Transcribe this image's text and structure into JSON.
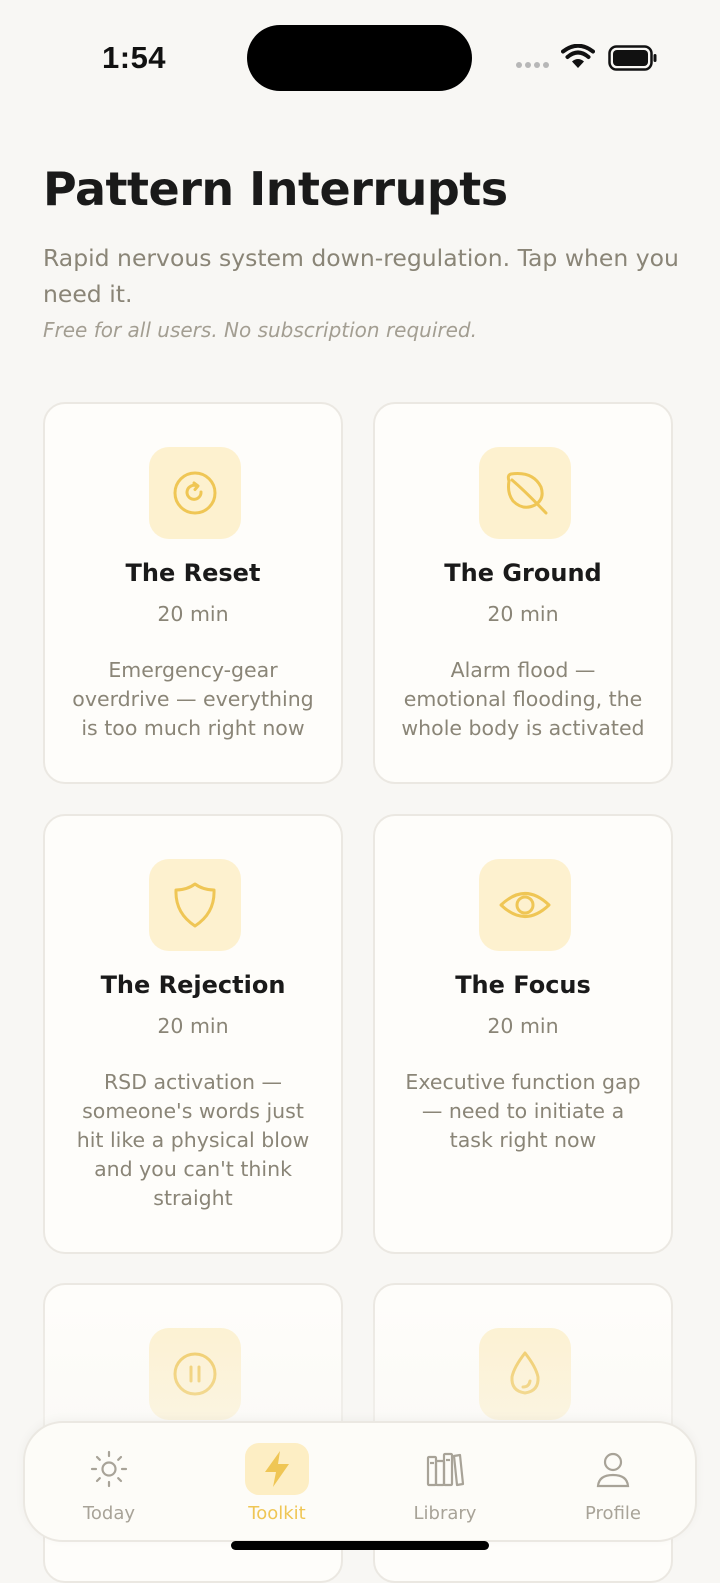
{
  "status_bar": {
    "time": "1:54"
  },
  "header": {
    "title": "Pattern Interrupts",
    "subtitle": "Rapid nervous system down-regulation. Tap when you need it.",
    "note": "Free for all users. No subscription required."
  },
  "cards": [
    {
      "name": "The Reset",
      "duration": "20 min",
      "description": "Emergency-gear overdrive — everything is too much right now",
      "icon": "refresh-icon"
    },
    {
      "name": "The Ground",
      "duration": "20 min",
      "description": "Alarm flood — emotional flooding, the whole body is activated",
      "icon": "leaf-icon"
    },
    {
      "name": "The Rejection",
      "duration": "20 min",
      "description": "RSD activation — someone's words just hit like a physical blow and you can't think straight",
      "icon": "shield-icon"
    },
    {
      "name": "The Focus",
      "duration": "20 min",
      "description": "Executive function gap — need to initiate a task right now",
      "icon": "eye-icon"
    },
    {
      "name": "",
      "duration": "",
      "description": "",
      "icon": "pause-icon"
    },
    {
      "name": "",
      "duration": "",
      "description": "",
      "icon": "droplet-icon"
    }
  ],
  "tabs": [
    {
      "label": "Today",
      "icon": "sun-icon",
      "active": false
    },
    {
      "label": "Toolkit",
      "icon": "lightning-icon",
      "active": true
    },
    {
      "label": "Library",
      "icon": "books-icon",
      "active": false
    },
    {
      "label": "Profile",
      "icon": "person-icon",
      "active": false
    }
  ],
  "colors": {
    "accent": "#efc655",
    "icon_tile": "#fdf1cf",
    "background": "#f8f7f4",
    "muted_text": "#8a8577"
  }
}
